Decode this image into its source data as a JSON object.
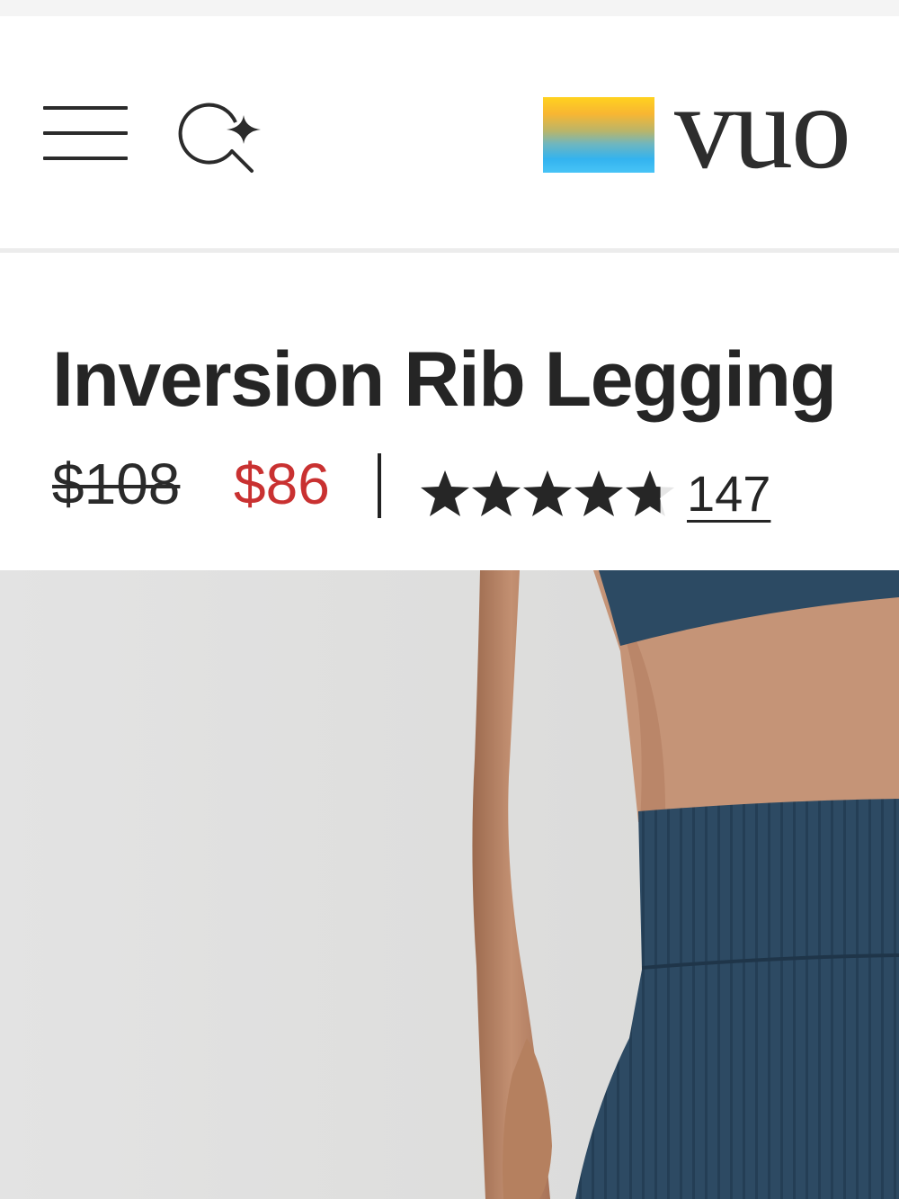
{
  "header": {
    "menu_icon": "hamburger-menu-icon",
    "search_icon": "ai-search-icon",
    "logo_text": "vuo",
    "logo_colors": [
      "#ffd21f",
      "#f8b632",
      "#6fb6bf",
      "#33b3ef"
    ]
  },
  "product": {
    "title": "Inversion Rib Legging",
    "original_price": "$108",
    "sale_price": "$86",
    "sale_color": "#c93131",
    "rating": 4.7,
    "rating_max": 5,
    "review_count": "147"
  }
}
